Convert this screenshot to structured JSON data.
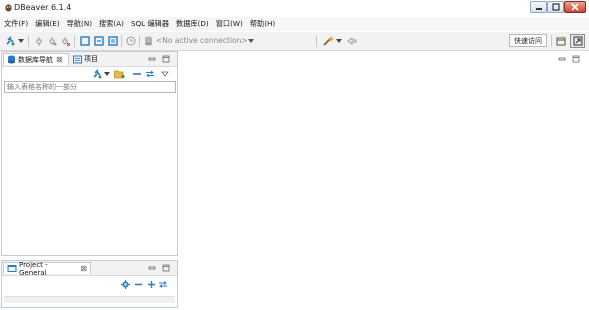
{
  "window": {
    "title": "DBeaver 6.1.4",
    "icons": [
      "dbeaver-logo-icon",
      "minimize-icon",
      "maximize-icon",
      "close-icon"
    ]
  },
  "menu": {
    "items": [
      {
        "label": "文件(F)"
      },
      {
        "label": "编辑(E)"
      },
      {
        "label": "导航(N)"
      },
      {
        "label": "搜索(A)"
      },
      {
        "label": "SQL 编辑器"
      },
      {
        "label": "数据库(D)"
      },
      {
        "label": "窗口(W)"
      },
      {
        "label": "帮助(H)"
      }
    ]
  },
  "toolbar": {
    "connection_text": "<No active connection>",
    "quick_access_label": "快速访问"
  },
  "navigator": {
    "tabs": [
      {
        "label": "数据库导航",
        "icon": "database-navigator-icon"
      },
      {
        "label": "项目",
        "icon": "project-icon"
      }
    ],
    "filter_placeholder": "输入表格名称的一部分"
  },
  "project_panel": {
    "tab_label": "Project - General"
  },
  "colors": {
    "accent_blue": "#2b7bc6",
    "panel_border": "#c3ccd8",
    "close_red": "#c94731"
  }
}
